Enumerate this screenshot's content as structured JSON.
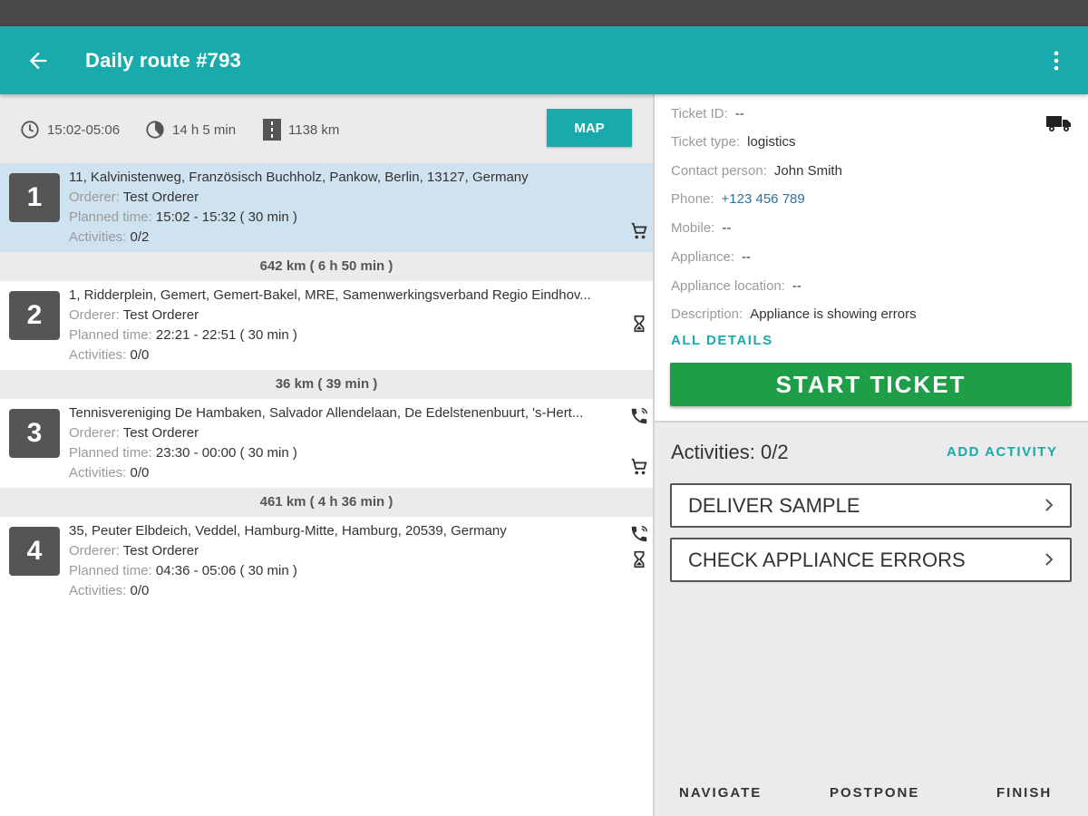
{
  "header": {
    "title": "Daily route #793"
  },
  "summary": {
    "time_range": "15:02-05:06",
    "duration": "14 h 5 min",
    "distance": "1138 km",
    "map_label": "MAP"
  },
  "stops": [
    {
      "number": "1",
      "address": "11, Kalvinistenweg, Französisch Buchholz, Pankow, Berlin, 13127, Germany",
      "orderer_label": "Orderer:",
      "orderer": "Test Orderer",
      "time_label": "Planned time:",
      "time": "15:02 - 15:32 ( 30 min )",
      "activities_label": "Activities:",
      "activities": "0/2"
    },
    {
      "number": "2",
      "address": "1, Ridderplein, Gemert, Gemert-Bakel, MRE, Samenwerkingsverband Regio Eindhov...",
      "orderer_label": "Orderer:",
      "orderer": "Test Orderer",
      "time_label": "Planned time:",
      "time": "22:21 - 22:51 ( 30 min )",
      "activities_label": "Activities:",
      "activities": "0/0"
    },
    {
      "number": "3",
      "address": "Tennisvereniging De Hambaken, Salvador Allendelaan, De Edelstenenbuurt, 's-Hert...",
      "orderer_label": "Orderer:",
      "orderer": "Test Orderer",
      "time_label": "Planned time:",
      "time": "23:30 - 00:00 ( 30 min )",
      "activities_label": "Activities:",
      "activities": "0/0"
    },
    {
      "number": "4",
      "address": "35, Peuter Elbdeich, Veddel, Hamburg-Mitte, Hamburg, 20539, Germany",
      "orderer_label": "Orderer:",
      "orderer": "Test Orderer",
      "time_label": "Planned time:",
      "time": "04:36 - 05:06 ( 30 min )",
      "activities_label": "Activities:",
      "activities": "0/0"
    }
  ],
  "legs": [
    "642 km ( 6 h 50 min )",
    "36 km ( 39 min )",
    "461 km ( 4 h 36 min )"
  ],
  "ticket": {
    "id_label": "Ticket ID:",
    "id": "--",
    "type_label": "Ticket type:",
    "type": "logistics",
    "contact_label": "Contact person:",
    "contact": "John Smith",
    "phone_label": "Phone:",
    "phone": "+123 456 789",
    "mobile_label": "Mobile:",
    "mobile": "--",
    "appliance_label": "Appliance:",
    "appliance": "--",
    "location_label": "Appliance location:",
    "location": "--",
    "description_label": "Description:",
    "description": "Appliance is showing errors",
    "all_details": "ALL DETAILS",
    "start_label": "START TICKET"
  },
  "activities": {
    "title": "Activities: 0/2",
    "add_label": "ADD ACTIVITY",
    "items": [
      "DELIVER SAMPLE",
      "CHECK APPLIANCE ERRORS"
    ]
  },
  "actions": {
    "navigate": "NAVIGATE",
    "postpone": "POSTPONE",
    "finish": "FINISH"
  },
  "colors": {
    "primary": "#19aaab",
    "start": "#1f9e48",
    "selected": "#cfe2ef",
    "link": "#2e6f9c"
  }
}
